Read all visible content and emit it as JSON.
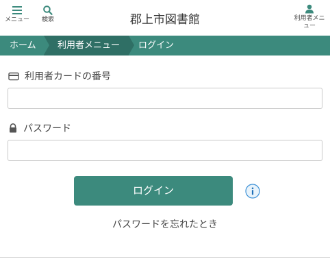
{
  "header": {
    "title": "郡上市図書館",
    "menu_label": "メニュー",
    "search_label": "検索",
    "user_menu_label": "利用者メニュー",
    "menu_icon": "hamburger-menu-icon",
    "search_icon": "search-icon",
    "user_icon": "user-icon"
  },
  "breadcrumb": {
    "items": [
      {
        "label": "ホーム"
      },
      {
        "label": "利用者メニュー"
      },
      {
        "label": "ログイン"
      }
    ]
  },
  "form": {
    "card_label": "利用者カードの番号",
    "card_icon": "credit-card-icon",
    "card_value": "",
    "password_label": "パスワード",
    "password_icon": "lock-icon",
    "password_value": "",
    "login_button": "ログイン",
    "info_icon": "info-icon",
    "forgot_password": "パスワードを忘れたとき"
  },
  "colors": {
    "accent": "#3c8a7d",
    "accent_dark": "#2f6f65",
    "info_blue": "#3a8fd6"
  }
}
